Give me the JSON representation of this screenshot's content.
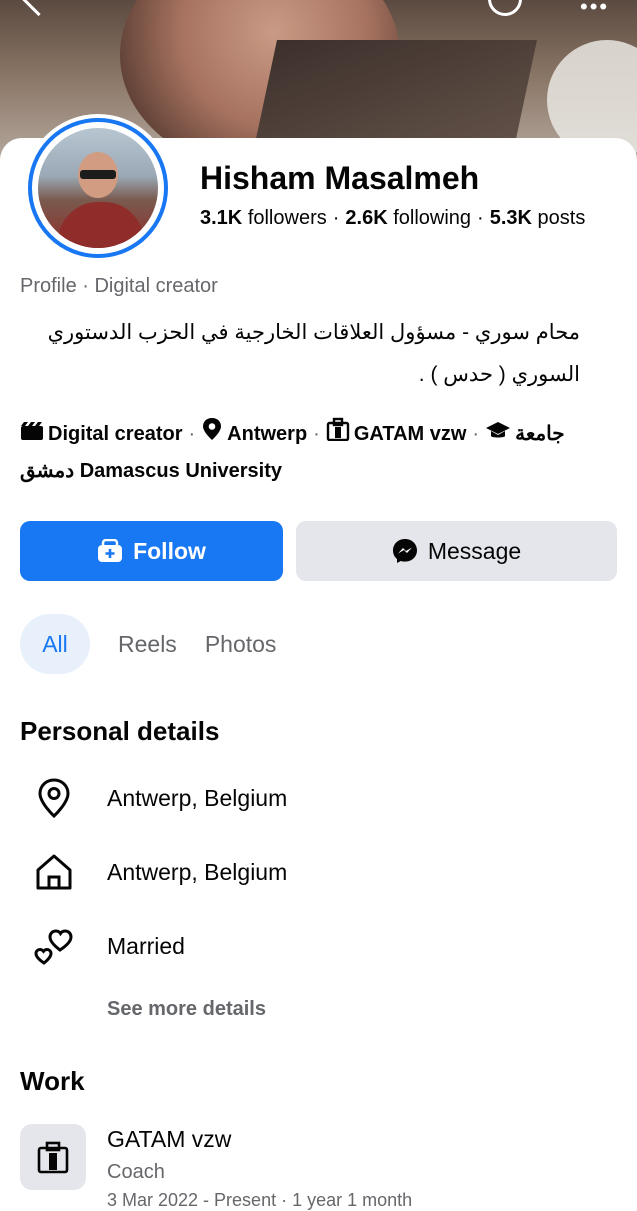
{
  "profile": {
    "name": "Hisham Masalmeh",
    "followers_count": "3.1K",
    "followers_label": "followers",
    "following_count": "2.6K",
    "following_label": "following",
    "posts_count": "5.3K",
    "posts_label": "posts",
    "profile_line": "Profile · Digital creator",
    "bio": "محام سوري - مسؤول العلاقات الخارجية في الحزب الدستوري السوري ( حدس ) .",
    "facts": {
      "category": "Digital creator",
      "city": "Antwerp",
      "workplace": "GATAM vzw",
      "education": "جامعة دمشق Damascus University"
    }
  },
  "actions": {
    "follow_label": "Follow",
    "message_label": "Message"
  },
  "tabs": [
    {
      "label": "All",
      "active": true
    },
    {
      "label": "Reels",
      "active": false
    },
    {
      "label": "Photos",
      "active": false
    }
  ],
  "personal_details": {
    "heading": "Personal details",
    "items": [
      {
        "icon": "location-pin-icon",
        "text": "Antwerp, Belgium"
      },
      {
        "icon": "home-icon",
        "text": "Antwerp, Belgium"
      },
      {
        "icon": "hearts-icon",
        "text": "Married"
      }
    ],
    "see_more": "See more details"
  },
  "work": {
    "heading": "Work",
    "employer": "GATAM vzw",
    "position": "Coach",
    "dates_partial": "3 Mar 2022 - Present · 1 year 1 month"
  },
  "colors": {
    "accent": "#1877f2",
    "secondary_button": "#e4e6eb",
    "muted_text": "#65676b"
  }
}
